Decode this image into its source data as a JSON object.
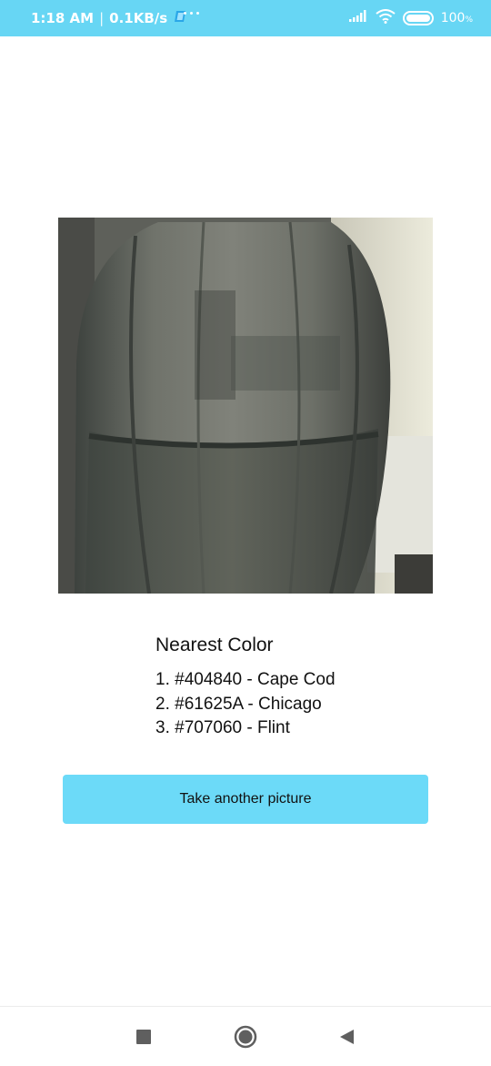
{
  "status_bar": {
    "time": "1:18 AM",
    "separator": "|",
    "net_speed": "0.1KB/s",
    "battery_level": "100",
    "battery_unit": "%",
    "background_color": "#67d6f4"
  },
  "result": {
    "title": "Nearest Color",
    "colors": [
      {
        "label": "1. #404840 - Cape Cod"
      },
      {
        "label": "2. #61625A - Chicago"
      },
      {
        "label": "3. #707060 - Flint"
      }
    ]
  },
  "actions": {
    "retake_label": "Take another picture",
    "button_color": "#6cdaf8"
  },
  "nav_bar": {
    "icons": [
      "recents-square-icon",
      "home-circle-icon",
      "back-triangle-icon"
    ]
  }
}
